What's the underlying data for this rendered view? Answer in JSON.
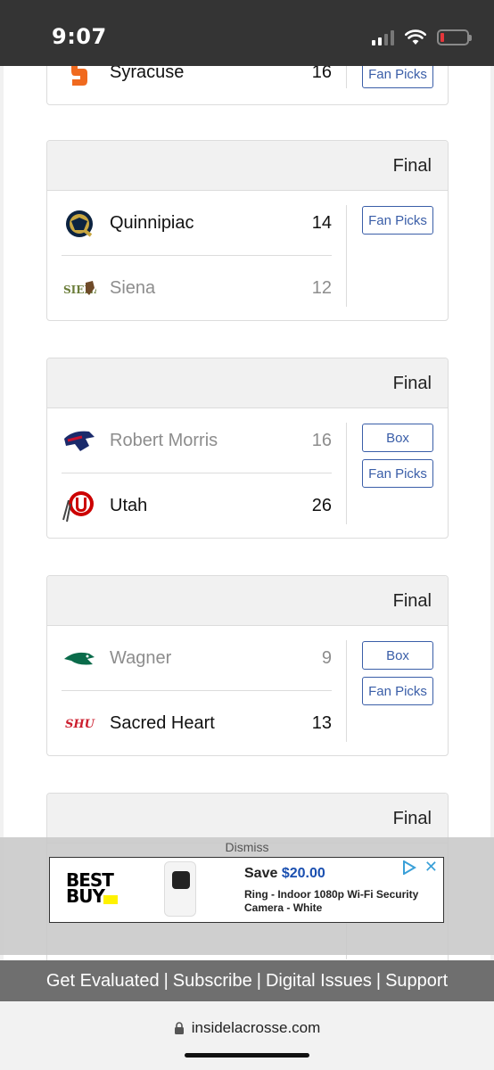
{
  "status_bar": {
    "time": "9:07"
  },
  "games": [
    {
      "status": "",
      "teams": [
        {
          "name": "Syracuse",
          "score": "16",
          "winner": true
        }
      ],
      "buttons": [
        "Fan Picks"
      ]
    },
    {
      "status": "Final",
      "teams": [
        {
          "name": "Quinnipiac",
          "score": "14",
          "winner": true
        },
        {
          "name": "Siena",
          "score": "12",
          "winner": false
        }
      ],
      "buttons": [
        "Fan Picks"
      ]
    },
    {
      "status": "Final",
      "teams": [
        {
          "name": "Robert Morris",
          "score": "16",
          "winner": false
        },
        {
          "name": "Utah",
          "score": "26",
          "winner": true
        }
      ],
      "buttons": [
        "Box",
        "Fan Picks"
      ]
    },
    {
      "status": "Final",
      "teams": [
        {
          "name": "Wagner",
          "score": "9",
          "winner": false
        },
        {
          "name": "Sacred Heart",
          "score": "13",
          "winner": true
        }
      ],
      "buttons": [
        "Box",
        "Fan Picks"
      ]
    },
    {
      "status": "Final",
      "teams": [],
      "buttons": []
    }
  ],
  "ad": {
    "dismiss_label": "Dismiss",
    "brand": "BEST BUY",
    "price_prefix": "Save ",
    "price": "$20.00",
    "description": "Ring - Indoor 1080p Wi-Fi Security Camera - White",
    "close_icon": "close-icon"
  },
  "footer": {
    "links": [
      "Get Evaluated",
      "Subscribe",
      "Digital Issues",
      "Support"
    ],
    "separator": "|"
  },
  "browser": {
    "url": "insidelacrosse.com"
  },
  "colors": {
    "button_border": "#3a5ea8",
    "status_bar": "#343434",
    "footer_bg": "#6f6f6f"
  }
}
